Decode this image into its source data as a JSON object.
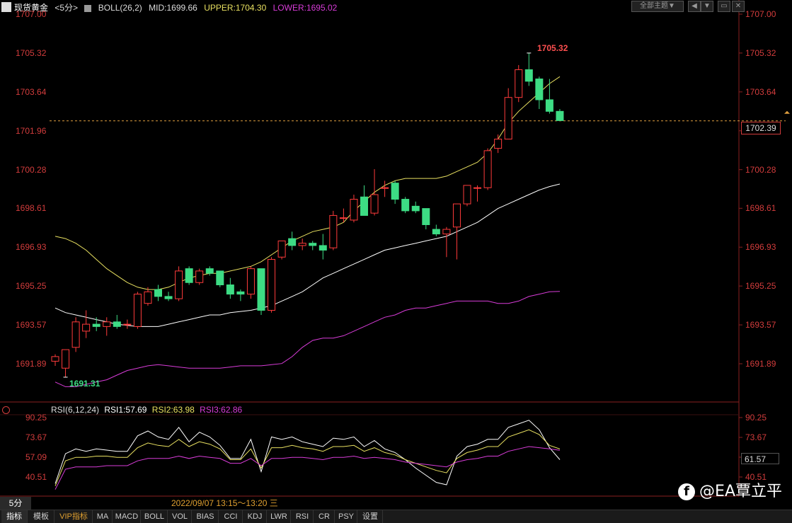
{
  "header": {
    "symbol": "现货黄金",
    "period": "<5分>",
    "boll_label": "BOLL(26,2)",
    "mid": "MID:1699.66",
    "upper": "UPPER:1704.30",
    "lower": "LOWER:1695.02",
    "theme_button": "全部主题▼"
  },
  "colors": {
    "up": "#ff3b3b",
    "down": "#3ddc84",
    "axis_text": "#d23c3c",
    "upper_band": "#e8e060",
    "mid_band": "#ffffff",
    "lower_band": "#d83cd8",
    "rsi1": "#ffffff",
    "rsi2": "#e8e060",
    "rsi3": "#d83cd8"
  },
  "price_axis": {
    "labels": [
      "1707.00",
      "1705.32",
      "1703.64",
      "1701.96",
      "1700.28",
      "1698.61",
      "1696.93",
      "1695.25",
      "1693.57",
      "1691.89"
    ],
    "current": "1702.39",
    "high_marker": "1705.32",
    "low_marker": "1691.31"
  },
  "rsi": {
    "label": "RSI(6,12,24)",
    "rsi1": "RSI1:57.69",
    "rsi2": "RSI2:63.98",
    "rsi3": "RSI3:62.86",
    "axis_labels": [
      "90.25",
      "73.67",
      "57.09",
      "40.51"
    ],
    "current": "61.57"
  },
  "status": {
    "period_tab": "5分",
    "time_range": "2022/09/07 13:15～13:20 三"
  },
  "bottom_tabs": [
    "指标",
    "模板",
    "VIP指标",
    "MA",
    "MACD",
    "BOLL",
    "VOL",
    "BIAS",
    "CCI",
    "KDJ",
    "LWR",
    "RSI",
    "CR",
    "PSY",
    "设置"
  ],
  "watermark": "@EA覃立平",
  "chart_data": {
    "type": "candlestick",
    "ylim": [
      1691.0,
      1707.0
    ],
    "candles": [
      {
        "o": 1692.0,
        "h": 1692.3,
        "l": 1691.8,
        "c": 1692.2
      },
      {
        "o": 1691.7,
        "h": 1692.5,
        "l": 1691.31,
        "c": 1692.5
      },
      {
        "o": 1692.6,
        "h": 1693.9,
        "l": 1692.4,
        "c": 1693.7
      },
      {
        "o": 1693.3,
        "h": 1694.2,
        "l": 1693.0,
        "c": 1693.6
      },
      {
        "o": 1693.6,
        "h": 1693.9,
        "l": 1693.3,
        "c": 1693.5
      },
      {
        "o": 1693.5,
        "h": 1693.9,
        "l": 1693.1,
        "c": 1693.7
      },
      {
        "o": 1693.7,
        "h": 1694.0,
        "l": 1693.4,
        "c": 1693.5
      },
      {
        "o": 1693.6,
        "h": 1693.8,
        "l": 1693.4,
        "c": 1693.6
      },
      {
        "o": 1693.5,
        "h": 1695.0,
        "l": 1693.4,
        "c": 1694.9
      },
      {
        "o": 1694.5,
        "h": 1695.2,
        "l": 1694.4,
        "c": 1695.0
      },
      {
        "o": 1695.1,
        "h": 1695.3,
        "l": 1694.6,
        "c": 1694.8
      },
      {
        "o": 1694.8,
        "h": 1695.0,
        "l": 1694.6,
        "c": 1694.7
      },
      {
        "o": 1694.7,
        "h": 1696.1,
        "l": 1694.6,
        "c": 1695.9
      },
      {
        "o": 1696.0,
        "h": 1696.1,
        "l": 1695.3,
        "c": 1695.4
      },
      {
        "o": 1695.4,
        "h": 1696.0,
        "l": 1695.3,
        "c": 1695.9
      },
      {
        "o": 1696.0,
        "h": 1696.1,
        "l": 1695.7,
        "c": 1695.8
      },
      {
        "o": 1695.9,
        "h": 1695.9,
        "l": 1695.2,
        "c": 1695.3
      },
      {
        "o": 1695.3,
        "h": 1695.6,
        "l": 1694.7,
        "c": 1694.9
      },
      {
        "o": 1695.0,
        "h": 1695.1,
        "l": 1694.6,
        "c": 1694.9
      },
      {
        "o": 1694.9,
        "h": 1696.1,
        "l": 1694.7,
        "c": 1696.0
      },
      {
        "o": 1696.0,
        "h": 1696.0,
        "l": 1694.0,
        "c": 1694.2
      },
      {
        "o": 1694.2,
        "h": 1696.5,
        "l": 1694.1,
        "c": 1696.4
      },
      {
        "o": 1696.5,
        "h": 1697.2,
        "l": 1696.4,
        "c": 1697.2
      },
      {
        "o": 1697.3,
        "h": 1697.6,
        "l": 1696.8,
        "c": 1697.0
      },
      {
        "o": 1697.0,
        "h": 1697.3,
        "l": 1696.8,
        "c": 1697.1
      },
      {
        "o": 1697.1,
        "h": 1697.2,
        "l": 1696.8,
        "c": 1697.0
      },
      {
        "o": 1697.0,
        "h": 1697.5,
        "l": 1696.4,
        "c": 1696.8
      },
      {
        "o": 1696.9,
        "h": 1698.5,
        "l": 1696.8,
        "c": 1698.3
      },
      {
        "o": 1698.2,
        "h": 1698.6,
        "l": 1698.0,
        "c": 1698.2
      },
      {
        "o": 1698.1,
        "h": 1699.2,
        "l": 1698.0,
        "c": 1699.0
      },
      {
        "o": 1699.1,
        "h": 1699.6,
        "l": 1698.3,
        "c": 1698.3
      },
      {
        "o": 1698.4,
        "h": 1700.3,
        "l": 1698.3,
        "c": 1699.2
      },
      {
        "o": 1699.5,
        "h": 1699.8,
        "l": 1699.1,
        "c": 1699.5
      },
      {
        "o": 1699.7,
        "h": 1699.8,
        "l": 1698.8,
        "c": 1699.0
      },
      {
        "o": 1699.0,
        "h": 1699.1,
        "l": 1698.4,
        "c": 1698.5
      },
      {
        "o": 1698.7,
        "h": 1698.9,
        "l": 1698.4,
        "c": 1698.5
      },
      {
        "o": 1698.6,
        "h": 1698.6,
        "l": 1697.7,
        "c": 1697.9
      },
      {
        "o": 1697.7,
        "h": 1697.9,
        "l": 1697.4,
        "c": 1697.5
      },
      {
        "o": 1697.5,
        "h": 1697.8,
        "l": 1696.5,
        "c": 1697.7
      },
      {
        "o": 1697.8,
        "h": 1698.8,
        "l": 1696.4,
        "c": 1698.8
      },
      {
        "o": 1698.8,
        "h": 1699.6,
        "l": 1698.7,
        "c": 1699.6
      },
      {
        "o": 1699.5,
        "h": 1699.6,
        "l": 1698.9,
        "c": 1699.5
      },
      {
        "o": 1699.5,
        "h": 1701.2,
        "l": 1699.4,
        "c": 1701.1
      },
      {
        "o": 1701.2,
        "h": 1701.8,
        "l": 1701.0,
        "c": 1701.6
      },
      {
        "o": 1701.6,
        "h": 1703.8,
        "l": 1701.6,
        "c": 1703.4
      },
      {
        "o": 1703.4,
        "h": 1704.8,
        "l": 1703.2,
        "c": 1704.6
      },
      {
        "o": 1704.6,
        "h": 1705.32,
        "l": 1703.9,
        "c": 1704.1
      },
      {
        "o": 1704.2,
        "h": 1704.3,
        "l": 1702.9,
        "c": 1703.3
      },
      {
        "o": 1703.3,
        "h": 1704.2,
        "l": 1702.7,
        "c": 1702.8
      },
      {
        "o": 1702.8,
        "h": 1702.9,
        "l": 1702.4,
        "c": 1702.4
      }
    ],
    "upper_band": [
      1697.4,
      1697.3,
      1697.1,
      1696.8,
      1696.4,
      1696.0,
      1695.7,
      1695.4,
      1695.2,
      1695.1,
      1695.1,
      1695.2,
      1695.4,
      1695.6,
      1695.7,
      1695.8,
      1695.8,
      1695.9,
      1696.0,
      1696.1,
      1696.3,
      1696.6,
      1696.9,
      1697.2,
      1697.4,
      1697.6,
      1697.7,
      1697.8,
      1698.0,
      1698.5,
      1698.9,
      1699.3,
      1699.6,
      1699.8,
      1699.9,
      1699.9,
      1699.9,
      1699.9,
      1700.0,
      1700.2,
      1700.4,
      1700.6,
      1701.0,
      1701.6,
      1702.3,
      1702.8,
      1703.2,
      1703.6,
      1704.0,
      1704.3
    ],
    "mid_band": [
      1694.3,
      1694.1,
      1694.0,
      1693.9,
      1693.8,
      1693.7,
      1693.6,
      1693.55,
      1693.5,
      1693.5,
      1693.5,
      1693.6,
      1693.7,
      1693.8,
      1693.9,
      1694.0,
      1694.0,
      1694.1,
      1694.15,
      1694.2,
      1694.3,
      1694.4,
      1694.6,
      1694.8,
      1695.0,
      1695.3,
      1695.6,
      1695.8,
      1696.0,
      1696.2,
      1696.4,
      1696.6,
      1696.8,
      1696.9,
      1697.0,
      1697.1,
      1697.2,
      1697.3,
      1697.4,
      1697.6,
      1697.8,
      1698.0,
      1698.3,
      1698.6,
      1698.8,
      1699.0,
      1699.2,
      1699.4,
      1699.55,
      1699.66
    ],
    "lower_band": [
      1691.1,
      1690.9,
      1690.9,
      1691.0,
      1691.1,
      1691.2,
      1691.4,
      1691.6,
      1691.7,
      1691.8,
      1691.85,
      1691.8,
      1691.75,
      1691.7,
      1691.7,
      1691.7,
      1691.7,
      1691.75,
      1691.8,
      1691.8,
      1691.8,
      1691.85,
      1691.9,
      1692.2,
      1692.6,
      1692.9,
      1693.0,
      1693.0,
      1693.1,
      1693.3,
      1693.5,
      1693.7,
      1693.9,
      1694.0,
      1694.2,
      1694.3,
      1694.3,
      1694.4,
      1694.5,
      1694.6,
      1694.6,
      1694.6,
      1694.6,
      1694.5,
      1694.5,
      1694.6,
      1694.8,
      1694.9,
      1695.0,
      1695.02
    ],
    "rsi_ylim": [
      30,
      100
    ],
    "rsi1": [
      35,
      60,
      64,
      62,
      64,
      63,
      62,
      62,
      75,
      79,
      74,
      72,
      82,
      70,
      78,
      74,
      67,
      56,
      56,
      72,
      45,
      74,
      72,
      74,
      70,
      68,
      66,
      73,
      72,
      74,
      66,
      71,
      64,
      61,
      55,
      48,
      42,
      36,
      34,
      58,
      66,
      68,
      72,
      72,
      82,
      85,
      88,
      80,
      65,
      55
    ],
    "rsi2": [
      33,
      54,
      57,
      57,
      58,
      58,
      57,
      57,
      65,
      69,
      67,
      66,
      72,
      66,
      70,
      68,
      64,
      55,
      55,
      64,
      48,
      65,
      65,
      67,
      65,
      64,
      62,
      66,
      66,
      67,
      62,
      65,
      61,
      59,
      55,
      52,
      49,
      46,
      44,
      56,
      61,
      63,
      66,
      66,
      74,
      77,
      80,
      76,
      67,
      63.98
    ],
    "rsi3": [
      30,
      47,
      49,
      49,
      49,
      50,
      50,
      50,
      54,
      56,
      56,
      56,
      58,
      56,
      58,
      57,
      56,
      52,
      52,
      56,
      50,
      56,
      56,
      57,
      57,
      56,
      55,
      57,
      57,
      58,
      56,
      57,
      56,
      55,
      53,
      52,
      51,
      50,
      49,
      53,
      55,
      56,
      58,
      58,
      62,
      64,
      66,
      65,
      64,
      62.86
    ]
  }
}
